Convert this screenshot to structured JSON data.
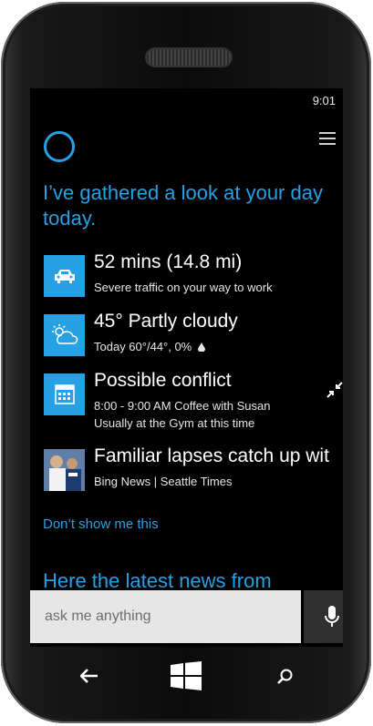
{
  "status_bar": {
    "time": "9:01"
  },
  "greeting": "I’ve gathered a look at your day today.",
  "cards": [
    {
      "title": "52 mins (14.8 mi)",
      "lines": [
        "Severe traffic on your way to work"
      ],
      "icon": "car-icon"
    },
    {
      "title": "45° Partly cloudy",
      "lines": [
        "Today 60°/44°, 0%"
      ],
      "icon": "weather-icon"
    },
    {
      "title": "Possible conflict",
      "lines": [
        "8:00 - 9:00 AM Coffee with Susan",
        "Usually at the Gym at this time"
      ],
      "icon": "calendar-icon"
    },
    {
      "title": "Familiar lapses catch up wit",
      "lines": [
        "Bing News | Seattle Times"
      ],
      "icon": "news-thumbnail"
    }
  ],
  "dont_show": "Don’t show me this",
  "news_heading": "Here the latest news from",
  "search": {
    "placeholder": "ask me anything"
  },
  "colors": {
    "accent": "#27a0e4",
    "background": "#000000"
  }
}
